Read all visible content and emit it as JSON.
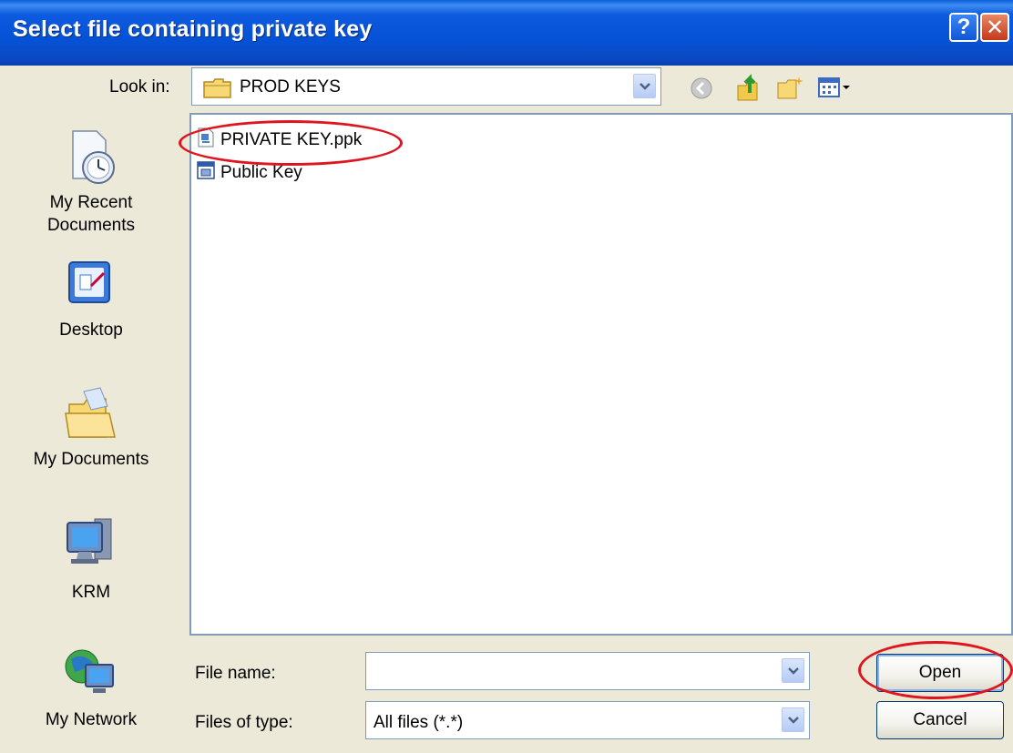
{
  "window": {
    "title": "Select file containing private key",
    "help_label": "?",
    "close_label": "✕"
  },
  "toolbar": {
    "lookin_label": "Look in:",
    "lookin_value": "PROD KEYS"
  },
  "places": [
    {
      "label1": "My Recent",
      "label2": "Documents"
    },
    {
      "label1": "Desktop"
    },
    {
      "label1": "My Documents"
    },
    {
      "label1": "KRM"
    },
    {
      "label1": "My Network"
    }
  ],
  "files": [
    {
      "name": "PRIVATE KEY.ppk"
    },
    {
      "name": "Public Key"
    }
  ],
  "form": {
    "filename_label": "File name:",
    "filename_value": "",
    "filetype_label": "Files of type:",
    "filetype_value": "All files (*.*)"
  },
  "buttons": {
    "open": "Open",
    "cancel": "Cancel"
  },
  "colors": {
    "titlebar": "#0552d6",
    "dialog_bg": "#ece9d8",
    "callout": "#e0141e"
  }
}
